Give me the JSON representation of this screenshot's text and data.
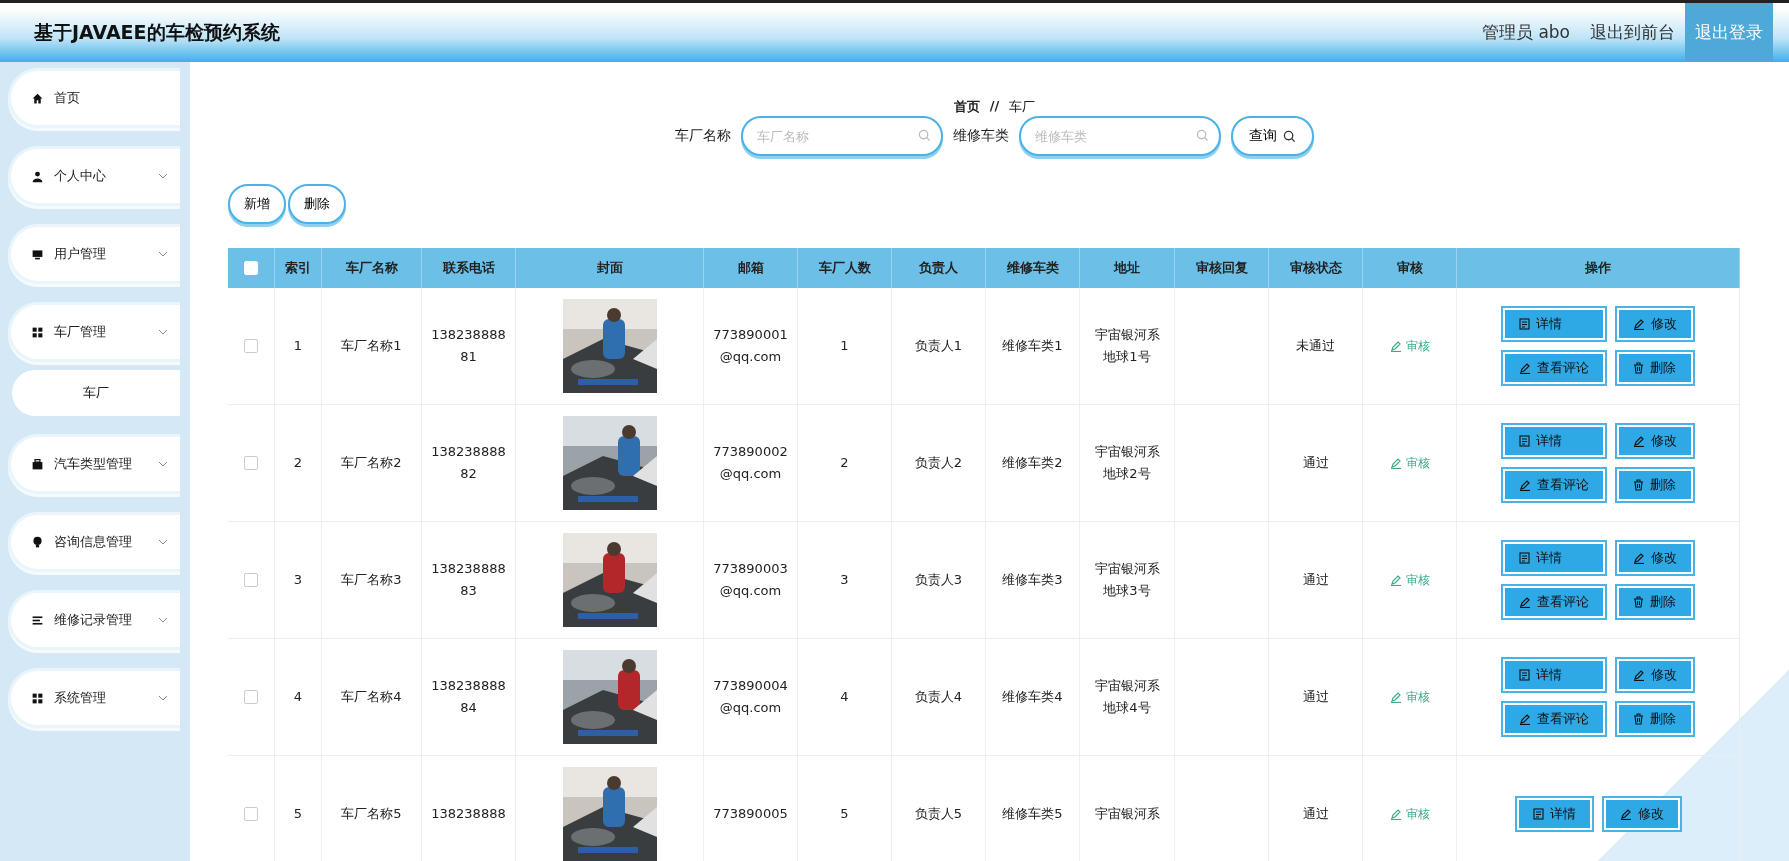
{
  "header": {
    "title": "基于JAVAEE的车检预约系统",
    "links": [
      {
        "label": "管理员 abo",
        "selected": false
      },
      {
        "label": "退出到前台",
        "selected": false
      },
      {
        "label": "退出登录",
        "selected": true
      }
    ]
  },
  "sidebar": {
    "items": [
      {
        "label": "首页",
        "expandable": false
      },
      {
        "label": "个人中心",
        "expandable": true
      },
      {
        "label": "用户管理",
        "expandable": true
      },
      {
        "label": "车厂管理",
        "expandable": true,
        "children": [
          {
            "label": "车厂"
          }
        ]
      },
      {
        "label": "汽车类型管理",
        "expandable": true
      },
      {
        "label": "咨询信息管理",
        "expandable": true
      },
      {
        "label": "维修记录管理",
        "expandable": true
      },
      {
        "label": "系统管理",
        "expandable": true
      }
    ]
  },
  "breadcrumb": {
    "items": [
      "首页",
      "车厂"
    ],
    "separator": "//"
  },
  "search": {
    "fields": [
      {
        "label": "车厂名称",
        "placeholder": "车厂名称"
      },
      {
        "label": "维修车类",
        "placeholder": "维修车类"
      }
    ],
    "button": "查询"
  },
  "toolbar": [
    "新增",
    "删除"
  ],
  "table": {
    "select_all": {
      "checked": false
    },
    "columns": [
      "索引",
      "车厂名称",
      "联系电话",
      "封面",
      "邮箱",
      "车厂人数",
      "负责人",
      "维修车类",
      "地址",
      "审核回复",
      "审核状态",
      "审核",
      "操作"
    ],
    "rows": [
      {
        "checked": false,
        "index": "1",
        "name": "车厂名称1",
        "phone": [
          "138238888",
          "81"
        ],
        "cover": {
          "kind": "picture"
        },
        "email": [
          "773890001",
          "@qq.com"
        ],
        "staff": "1",
        "manager": "负责人1",
        "category": "维修车类1",
        "address": [
          "宇宙银河系",
          "地球1号"
        ],
        "status": "未通过",
        "review": "审核",
        "actions": [
          "详情",
          "修改",
          "查看评论",
          "删除"
        ]
      },
      {
        "checked": false,
        "index": "2",
        "name": "车厂名称2",
        "phone": [
          "138238888",
          "82"
        ],
        "cover": {
          "kind": "picture"
        },
        "email": [
          "773890002",
          "@qq.com"
        ],
        "staff": "2",
        "manager": "负责人2",
        "category": "维修车类2",
        "address": [
          "宇宙银河系",
          "地球2号"
        ],
        "status": "通过",
        "review": "审核",
        "actions": [
          "详情",
          "修改",
          "查看评论",
          "删除"
        ]
      },
      {
        "checked": false,
        "index": "3",
        "name": "车厂名称3",
        "phone": [
          "138238888",
          "83"
        ],
        "cover": {
          "kind": "picture"
        },
        "email": [
          "773890003",
          "@qq.com"
        ],
        "staff": "3",
        "manager": "负责人3",
        "category": "维修车类3",
        "address": [
          "宇宙银河系",
          "地球3号"
        ],
        "status": "通过",
        "review": "审核",
        "actions": [
          "详情",
          "修改",
          "查看评论",
          "删除"
        ]
      },
      {
        "checked": false,
        "index": "4",
        "name": "车厂名称4",
        "phone": [
          "138238888",
          "84"
        ],
        "cover": {
          "kind": "picture"
        },
        "email": [
          "773890004",
          "@qq.com"
        ],
        "staff": "4",
        "manager": "负责人4",
        "category": "维修车类4",
        "address": [
          "宇宙银河系",
          "地球4号"
        ],
        "status": "通过",
        "review": "审核",
        "actions": [
          "详情",
          "修改",
          "查看评论",
          "删除"
        ]
      },
      {
        "checked": false,
        "index": "5",
        "name": "车厂名称5",
        "phone": [
          "138238888"
        ],
        "cover": {
          "kind": "picture"
        },
        "email": [
          "773890005"
        ],
        "staff": "5",
        "manager": "负责人5",
        "category": "维修车类5",
        "address": [
          "宇宙银河系"
        ],
        "status": "通过",
        "review": "审核",
        "actions": [
          "详情",
          "修改"
        ]
      }
    ]
  }
}
